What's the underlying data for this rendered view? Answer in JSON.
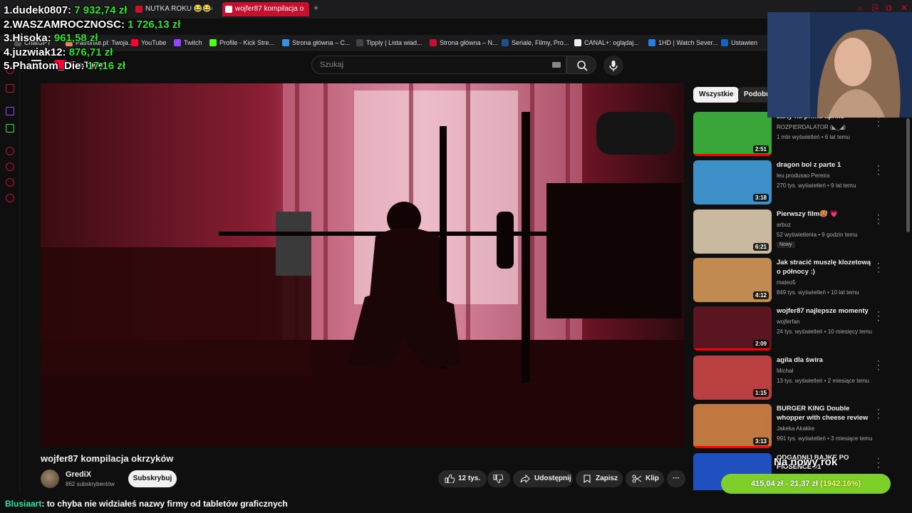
{
  "browser": {
    "tabs": [
      {
        "label": "NUTKA ROKU 😂😂😂",
        "icon_color": "#c8102e"
      },
      {
        "label": "wojfer87 kompilacja o",
        "icon_color": "#ff0033",
        "active": true
      }
    ],
    "new_tab": "+",
    "bookmarks": [
      {
        "label": "ChatGPT",
        "icon_color": "#555"
      },
      {
        "label": "Patronite.pl: Twoja...",
        "icon_color": "#e85"
      },
      {
        "label": "YouTube",
        "icon_color": "#ff0033"
      },
      {
        "label": "Twitch",
        "icon_color": "#9146ff"
      },
      {
        "label": "Profile - Kick Stre...",
        "icon_color": "#53fc18"
      },
      {
        "label": "Strona główna – C...",
        "icon_color": "#3a8ee6"
      },
      {
        "label": "Tipply | Lista wiad...",
        "icon_color": "#444"
      },
      {
        "label": "Strona główna – N...",
        "icon_color": "#c8102e"
      },
      {
        "label": "Seriale, Filmy, Pro...",
        "icon_color": "#1e4e8c"
      },
      {
        "label": "CANAL+: oglądaj...",
        "icon_color": "#eee"
      },
      {
        "label": "1HD | Watch Sever...",
        "icon_color": "#2a7de1"
      },
      {
        "label": "Ustawien",
        "icon_color": "#1565c0"
      }
    ],
    "window_controls": [
      "⌕",
      "⎘",
      "⧉",
      "✕"
    ]
  },
  "youtube": {
    "logo": "YouTube",
    "search_placeholder": "Szukaj",
    "video": {
      "title": "wojfer87 kompilacja okrzyków",
      "channel": "GrediX",
      "subscribers": "862 subskrybentów",
      "subscribe_label": "Subskrybuj",
      "likes": "12 tys.",
      "share_label": "Udostępnij",
      "save_label": "Zapisz",
      "clip_label": "Klip",
      "more": "···"
    },
    "chips": [
      "Wszystkie",
      "Podobn"
    ],
    "recommendations": [
      {
        "title": "żarty na prima aprilis",
        "channel": "ROZPIERDALATOR (◣_◢)",
        "meta": "1 mln wyświetleń • 6 lat temu",
        "duration": "2:51",
        "thumb": "#3aa63a",
        "progress": 1.0
      },
      {
        "title": "dragon bol z parte 1",
        "channel": "leu produsao Pereira",
        "meta": "270 tys. wyświetleń • 9 lat temu",
        "duration": "3:18",
        "thumb": "#3e90c8"
      },
      {
        "title": "Pierwszy film🥵 💗",
        "channel": "arbuz",
        "meta": "52 wyświetlenia • 9 godzin temu",
        "duration": "6:21",
        "thumb": "#c9b9a0",
        "badge": "Nowy"
      },
      {
        "title": "Jak stracić muszlę klozetową o północy :)",
        "channel": "mateo5",
        "meta": "849 tys. wyświetleń • 10 lat temu",
        "duration": "4:12",
        "thumb": "#c08a50"
      },
      {
        "title": "wojfer87 najlepsze momenty",
        "channel": "wojferfan",
        "meta": "24 tys. wyświetleń • 10 miesięcy temu",
        "duration": "2:09",
        "thumb": "#5a1520",
        "progress": 1.0
      },
      {
        "title": "agila dla świra",
        "channel": "Michał",
        "meta": "13 tys. wyświetleń • 2 miesiące temu",
        "duration": "1:15",
        "thumb": "#b84040"
      },
      {
        "title": "BURGER KING Double whopper with cheese review",
        "channel": "Jakeka Akakke",
        "meta": "991 tys. wyświetleń • 3 miesiące temu",
        "duration": "3:13",
        "thumb": "#c07840",
        "progress": 1.0
      },
      {
        "title": "ODGADNIJ BAJKĘ PO PIOSENCE #1",
        "channel": "",
        "meta": "",
        "duration": "",
        "thumb": "#2050c0"
      }
    ]
  },
  "overlay": {
    "donors": [
      {
        "rank_name": "1.dudek0807:",
        "amount": "7 932,74 zł"
      },
      {
        "rank_name": "2.WASZAMROCZNOSC:",
        "amount": "1 726,13 zł"
      },
      {
        "rank_name": "3.Hisoka:",
        "amount": "961,58 zł"
      },
      {
        "rank_name": "4.juzwiak12:",
        "amount": "876,71 zł"
      },
      {
        "rank_name": "5.Phantom_Die:",
        "amount": "17,16 zł"
      }
    ],
    "goal": {
      "label": "Na nowy rok",
      "progress_text": "415,04 zł - 21,37 zł",
      "percent_text": "(1942.16%)",
      "accent": "#7fcf2a"
    },
    "chat": {
      "user": "Blusiaart",
      "message": ": to chyba nie widziałeś nazwy firmy od tabletów graficznych"
    },
    "brand_color": "#c8102e"
  }
}
